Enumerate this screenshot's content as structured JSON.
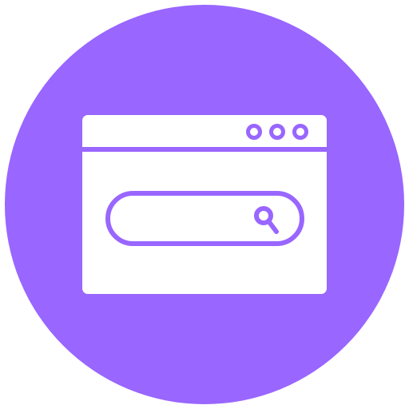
{
  "icon": {
    "name": "browser-search-icon",
    "background_color": "#9966ff",
    "foreground_color": "#ffffff"
  }
}
